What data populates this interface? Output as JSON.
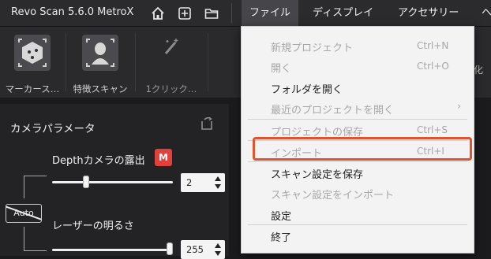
{
  "window": {
    "title": "Revo Scan 5.6.0 MetroX"
  },
  "menubar": {
    "items": [
      {
        "label": "ファイル",
        "active": true
      },
      {
        "label": "ディスプレイ"
      },
      {
        "label": "アクセサリー"
      },
      {
        "label": "ヘ"
      }
    ]
  },
  "toolbar": {
    "tools": [
      {
        "label": "マーカース…",
        "icon": "marker-scan-icon"
      },
      {
        "label": "特徴スキャン",
        "icon": "feature-scan-icon"
      },
      {
        "label": "1クリック…",
        "icon": "magic-wand-icon"
      }
    ],
    "partial_right_label": "化"
  },
  "camera_panel": {
    "title": "カメラパラメータ",
    "depth_exposure": {
      "label": "Depthカメラの露出",
      "mode_badge": "M",
      "value": "2",
      "level": 0.27
    },
    "auto_label": "Auto",
    "laser_brightness": {
      "label": "レーザーの明るさ",
      "value": "255",
      "level": 1.0
    }
  },
  "file_menu": {
    "items": [
      {
        "label": "新規プロジェクト",
        "shortcut": "Ctrl+N",
        "enabled": false
      },
      {
        "label": "開く",
        "shortcut": "Ctrl+O",
        "enabled": false
      },
      {
        "label": "フォルダを開く",
        "shortcut": "",
        "enabled": true
      },
      {
        "label": "最近のプロジェクトを開く",
        "shortcut": "",
        "enabled": false,
        "submenu": true
      },
      {
        "label": "プロジェクトの保存",
        "shortcut": "Ctrl+S",
        "enabled": false
      },
      {
        "label": "インポート",
        "shortcut": "Ctrl+I",
        "enabled": false,
        "highlighted": true
      },
      {
        "label": "スキャン設定を保存",
        "shortcut": "",
        "enabled": true
      },
      {
        "label": "スキャン設定をインポート",
        "shortcut": "",
        "enabled": false
      },
      {
        "label": "設定",
        "shortcut": "",
        "enabled": true
      },
      {
        "label": "終了",
        "shortcut": "",
        "enabled": true
      }
    ]
  },
  "colors": {
    "accent_highlight": "#e0532f",
    "mode_badge": "#e0413d",
    "menu_background": "#f3f3f3",
    "app_background": "#1b1b1d"
  }
}
